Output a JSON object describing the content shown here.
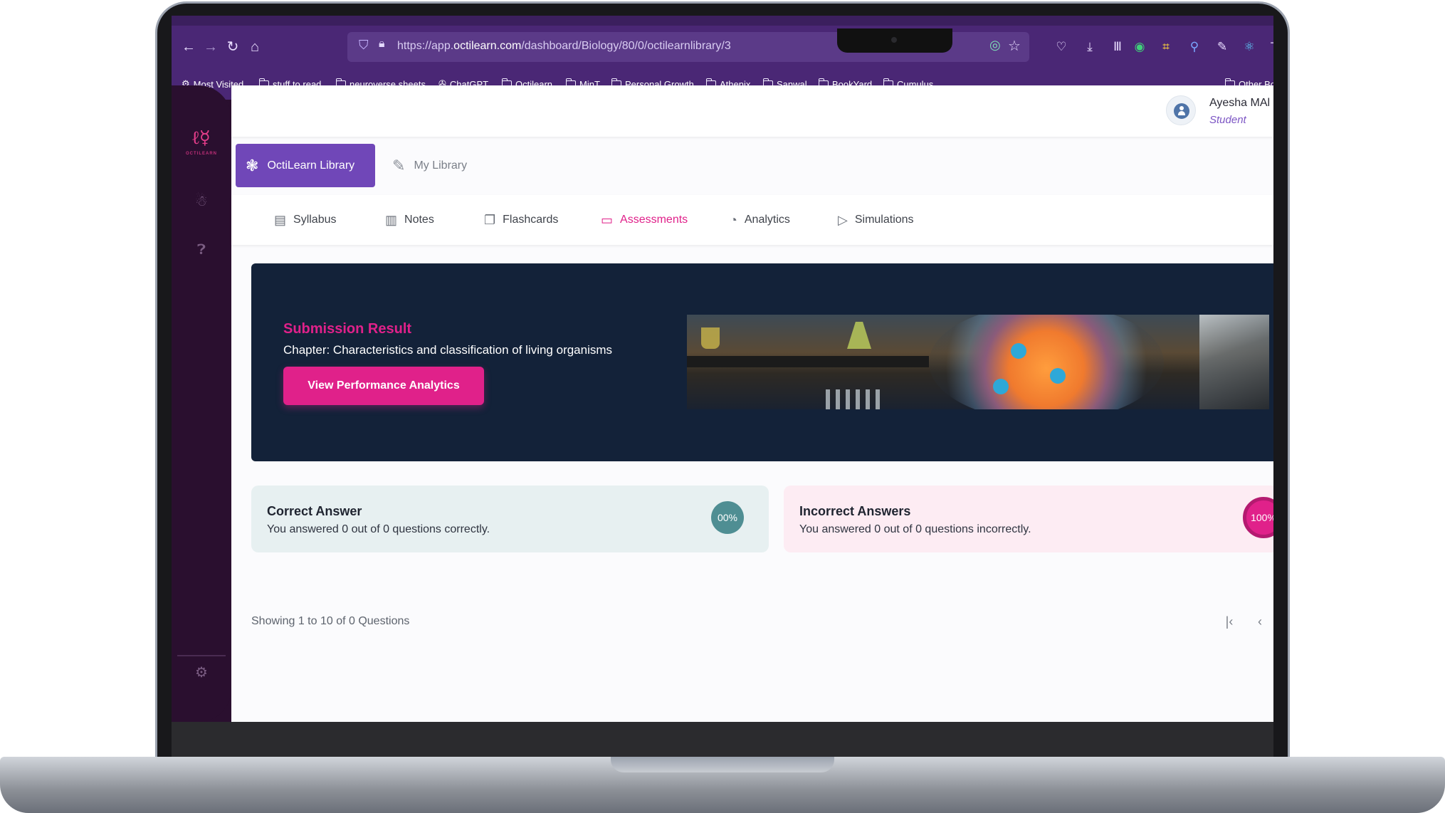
{
  "browser": {
    "url_prefix": "https://app.",
    "url_domain": "octilearn.com",
    "url_path": "/dashboard/Biology/80/0/octilearnlibrary/3",
    "bookmarks": [
      {
        "label": "Most Visited",
        "icon": "gear-icon"
      },
      {
        "label": "stuff to read",
        "icon": "folder-icon"
      },
      {
        "label": "neuroverse sheets",
        "icon": "folder-icon"
      },
      {
        "label": "ChatGPT",
        "icon": "chatgpt-icon"
      },
      {
        "label": "Octilearn",
        "icon": "folder-icon"
      },
      {
        "label": "MinT",
        "icon": "folder-icon"
      },
      {
        "label": "Personal Growth",
        "icon": "folder-icon"
      },
      {
        "label": "Athenix",
        "icon": "folder-icon"
      },
      {
        "label": "Sanwal",
        "icon": "folder-icon"
      },
      {
        "label": "BookYard",
        "icon": "folder-icon"
      },
      {
        "label": "Cumulus",
        "icon": "folder-icon"
      }
    ],
    "other_bookmarks": "Other Bo"
  },
  "user": {
    "name": "Ayesha MAl",
    "role": "Student"
  },
  "library_tabs": {
    "octilearn": "OctiLearn Library",
    "my_library": "My Library"
  },
  "sub_tabs": [
    {
      "label": "Syllabus",
      "icon": "syllabus-icon",
      "active": false
    },
    {
      "label": "Notes",
      "icon": "notes-icon",
      "active": false
    },
    {
      "label": "Flashcards",
      "icon": "flashcards-icon",
      "active": false
    },
    {
      "label": "Assessments",
      "icon": "assessment-icon",
      "active": true
    },
    {
      "label": "Analytics",
      "icon": "analytics-icon",
      "active": false
    },
    {
      "label": "Simulations",
      "icon": "play-icon",
      "active": false
    }
  ],
  "result": {
    "title": "Submission Result",
    "chapter": "Chapter: Characteristics and classification of living organisms",
    "button": "View Performance Analytics"
  },
  "correct": {
    "title": "Correct Answer",
    "desc": "You answered 0 out of 0 questions correctly.",
    "percent": "00%"
  },
  "incorrect": {
    "title": "Incorrect Answers",
    "desc": "You answered 0 out of 0 questions incorrectly.",
    "percent": "100%"
  },
  "pagination": {
    "status": "Showing 1 to 10 of 0 Questions"
  },
  "colors": {
    "accent": "#e0218a",
    "primary": "#7047b8",
    "sidebar": "#2a0f2f",
    "banner": "#132239"
  }
}
